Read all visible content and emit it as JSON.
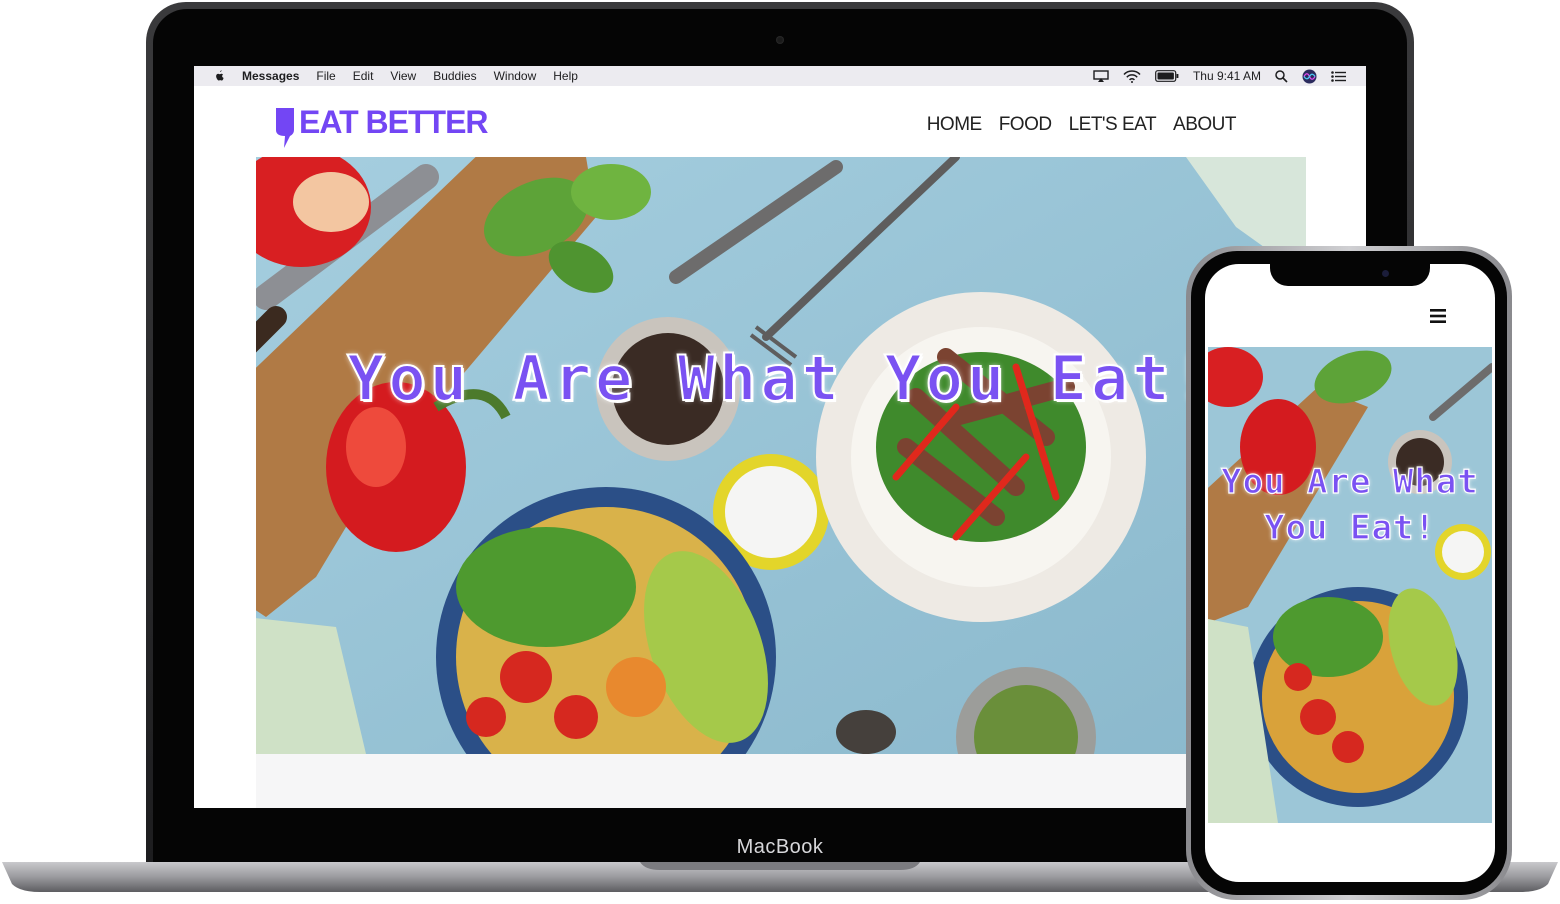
{
  "menubar": {
    "app_name": "Messages",
    "menus": [
      "File",
      "Edit",
      "View",
      "Buddies",
      "Window",
      "Help"
    ],
    "clock": "Thu 9:41 AM"
  },
  "site": {
    "logo_text": "EAT BETTER",
    "nav": [
      "HOME",
      "FOOD",
      "LET'S EAT",
      "ABOUT"
    ],
    "hero_title": "You Are What You Eat!",
    "brand_color": "#7346f4"
  },
  "device": {
    "laptop_label": "MacBook"
  },
  "phone": {
    "hero_line1": "You Are What",
    "hero_line2": "You Eat!"
  }
}
